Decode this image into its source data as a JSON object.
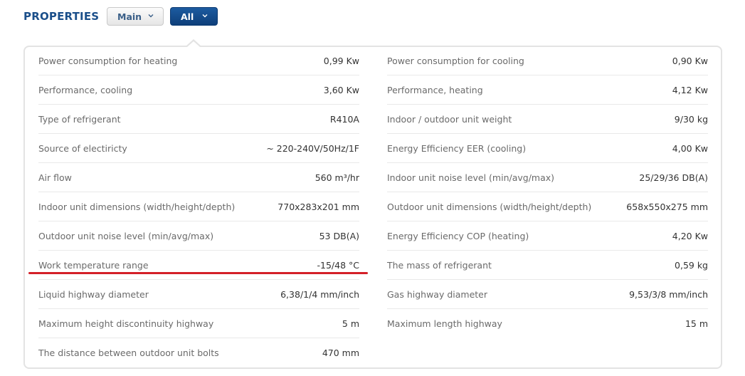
{
  "header": {
    "title": "PROPERTIES",
    "buttons": [
      {
        "label": "Main"
      },
      {
        "label": "All"
      }
    ]
  },
  "colors": {
    "title": "#1b4f8a",
    "active_button": "#0e3f7a",
    "highlight_line": "#d42028"
  },
  "properties": {
    "left": [
      {
        "label": "Power consumption for heating",
        "value": "0,99 Kw"
      },
      {
        "label": "Performance, cooling",
        "value": "3,60 Kw"
      },
      {
        "label": "Type of refrigerant",
        "value": "R410A"
      },
      {
        "label": "Source of electiricty",
        "value": "~ 220-240V/50Hz/1F"
      },
      {
        "label": "Air flow",
        "value": "560 m³/hr"
      },
      {
        "label": "Indoor unit dimensions (width/height/depth)",
        "value": "770x283x201 mm"
      },
      {
        "label": "Outdoor unit noise level (min/avg/max)",
        "value": "53 DB(A)"
      },
      {
        "label": "Work temperature range",
        "value": "-15/48 °C"
      },
      {
        "label": "Liquid highway diameter",
        "value": "6,38/1/4 mm/inch"
      },
      {
        "label": "Maximum height discontinuity highway",
        "value": "5 m"
      },
      {
        "label": "The distance between outdoor unit bolts",
        "value": "470 mm"
      }
    ],
    "right": [
      {
        "label": "Power consumption for cooling",
        "value": "0,90 Kw"
      },
      {
        "label": "Performance, heating",
        "value": "4,12 Kw"
      },
      {
        "label": "Indoor / outdoor unit weight",
        "value": "9/30 kg"
      },
      {
        "label": "Energy Efficiency EER (cooling)",
        "value": "4,00 Kw"
      },
      {
        "label": "Indoor unit noise level (min/avg/max)",
        "value": "25/29/36 DB(A)"
      },
      {
        "label": "Outdoor unit dimensions (width/height/depth)",
        "value": "658x550x275 mm"
      },
      {
        "label": "Energy Efficiency COP (heating)",
        "value": "4,20 Kw"
      },
      {
        "label": "The mass of refrigerant",
        "value": "0,59 kg"
      },
      {
        "label": "Gas highway diameter",
        "value": "9,53/3/8 mm/inch"
      },
      {
        "label": "Maximum length highway",
        "value": "15 m"
      }
    ]
  }
}
